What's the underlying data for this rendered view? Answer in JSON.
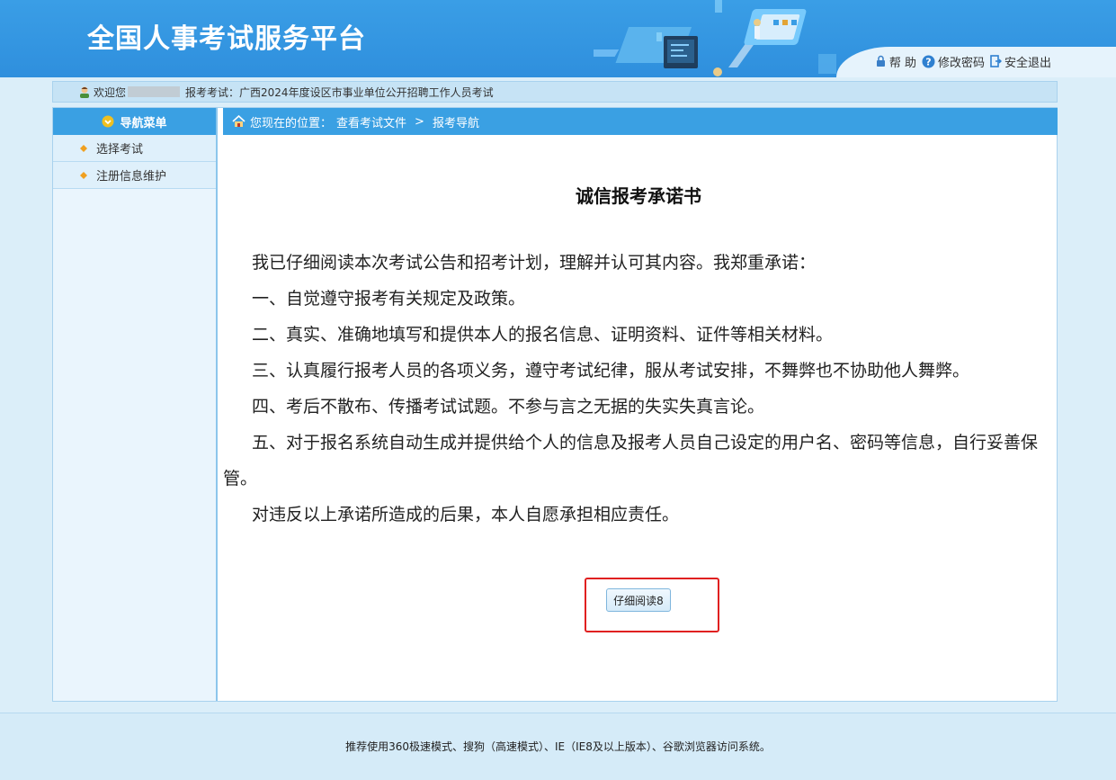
{
  "header": {
    "site_title": "全国人事考试服务平台",
    "links": {
      "help": "帮 助",
      "change_password": "修改密码",
      "logout": "安全退出"
    }
  },
  "welcome": {
    "greeting": "欢迎您",
    "exam_label": "报考考试：",
    "exam_name": "广西2024年度设区市事业单位公开招聘工作人员考试"
  },
  "sidebar": {
    "heading": "导航菜单",
    "items": [
      {
        "label": "选择考试"
      },
      {
        "label": "注册信息维护"
      }
    ]
  },
  "breadcrumb": {
    "prefix": "您现在的位置：",
    "path": "查看考试文件",
    "separator": ">",
    "current": "报考导航"
  },
  "document": {
    "title": "诚信报考承诺书",
    "paragraphs": [
      "我已仔细阅读本次考试公告和招考计划，理解并认可其内容。我郑重承诺：",
      "一、自觉遵守报考有关规定及政策。",
      "二、真实、准确地填写和提供本人的报名信息、证明资料、证件等相关材料。",
      "三、认真履行报考人员的各项义务，遵守考试纪律，服从考试安排，不舞弊也不协助他人舞弊。",
      "四、考后不散布、传播考试试题。不参与言之无据的失实失真言论。",
      "五、对于报名系统自动生成并提供给个人的信息及报考人员自己设定的用户名、密码等信息，自行妥善保管。",
      "对违反以上承诺所造成的后果，本人自愿承担相应责任。"
    ]
  },
  "read_button": {
    "label": "仔细阅读8"
  },
  "footer": {
    "text": "推荐使用360极速模式、搜狗（高速模式）、IE（IE8及以上版本）、谷歌浏览器访问系统。"
  },
  "colors": {
    "header_blue": "#3a9ee6",
    "bar_blue": "#3aa0e3",
    "highlight_red": "#e02020"
  }
}
